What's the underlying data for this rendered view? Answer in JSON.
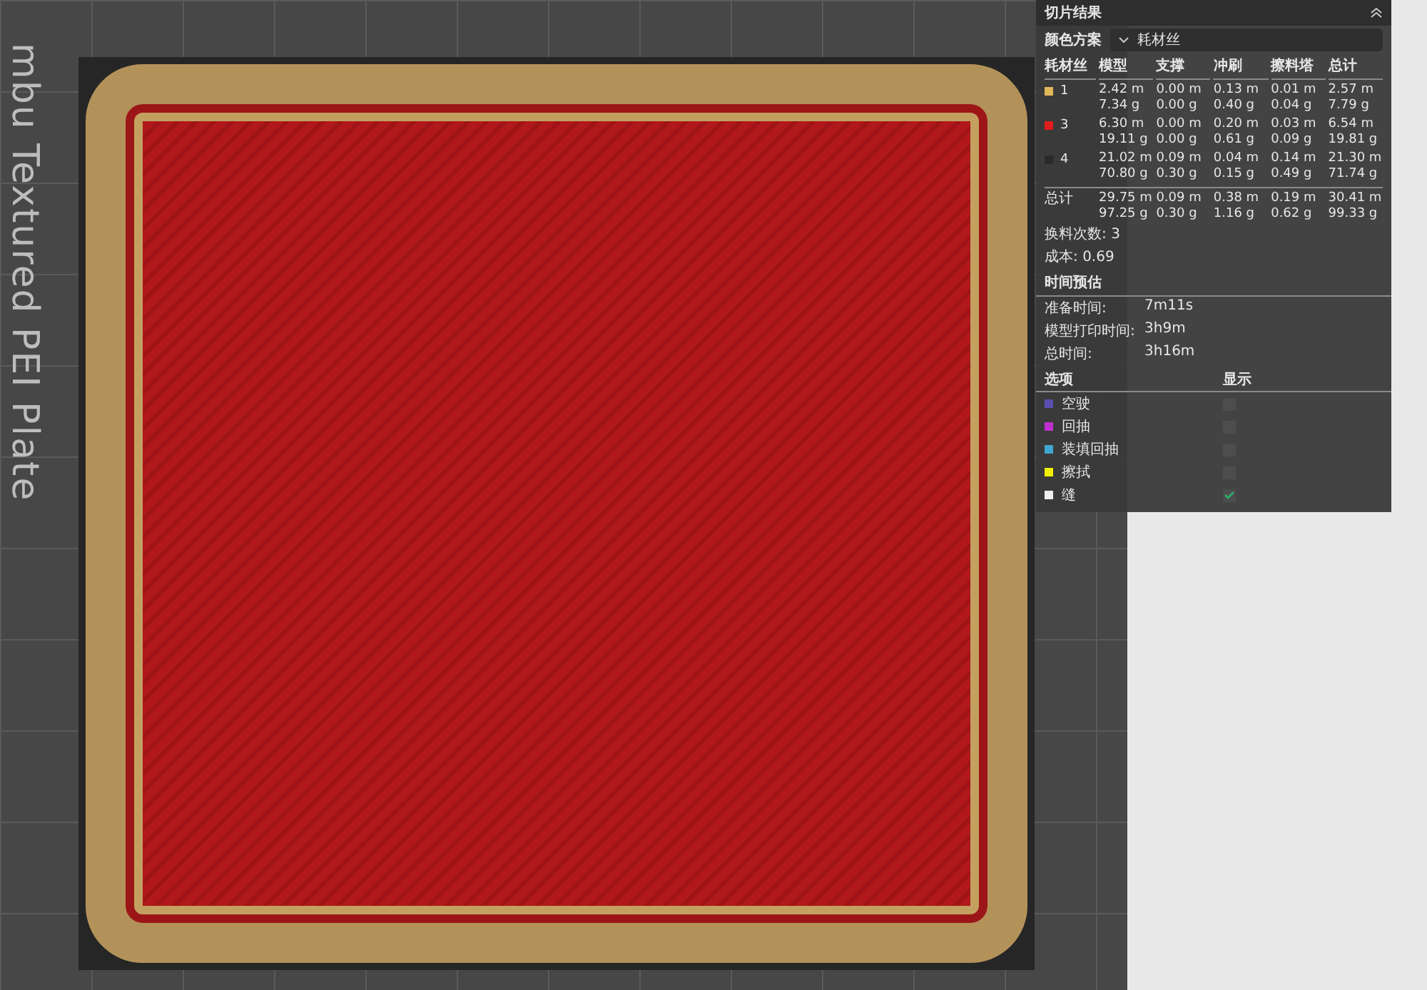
{
  "plate_label": "mbu Textured PEI Plate",
  "panel": {
    "title": "切片结果",
    "color_scheme": {
      "label": "颜色方案",
      "value": "耗材丝"
    },
    "filament_columns": [
      "耗材丝",
      "模型",
      "支撑",
      "冲刷",
      "擦料塔",
      "总计"
    ],
    "filaments": [
      {
        "id": "1",
        "color": "#e0b85a",
        "cells": [
          [
            "2.42 m",
            "7.34 g"
          ],
          [
            "0.00 m",
            "0.00 g"
          ],
          [
            "0.13 m",
            "0.40 g"
          ],
          [
            "0.01 m",
            "0.04 g"
          ],
          [
            "2.57 m",
            "7.79 g"
          ]
        ]
      },
      {
        "id": "3",
        "color": "#e01c1c",
        "cells": [
          [
            "6.30 m",
            "19.11 g"
          ],
          [
            "0.00 m",
            "0.00 g"
          ],
          [
            "0.20 m",
            "0.61 g"
          ],
          [
            "0.03 m",
            "0.09 g"
          ],
          [
            "6.54 m",
            "19.81 g"
          ]
        ]
      },
      {
        "id": "4",
        "color": "#2a2a2a",
        "cells": [
          [
            "21.02 m",
            "70.80 g"
          ],
          [
            "0.09 m",
            "0.30 g"
          ],
          [
            "0.04 m",
            "0.15 g"
          ],
          [
            "0.14 m",
            "0.49 g"
          ],
          [
            "21.30 m",
            "71.74 g"
          ]
        ]
      }
    ],
    "total": {
      "label": "总计",
      "cells": [
        [
          "29.75 m",
          "97.25 g"
        ],
        [
          "0.09 m",
          "0.30 g"
        ],
        [
          "0.38 m",
          "1.16 g"
        ],
        [
          "0.19 m",
          "0.62 g"
        ],
        [
          "30.41 m",
          "99.33 g"
        ]
      ]
    },
    "summary": [
      {
        "label": "换料次数:",
        "value": "3"
      },
      {
        "label": "成本:",
        "value": "0.69"
      }
    ],
    "time_title": "时间预估",
    "times": [
      {
        "label": "准备时间:",
        "value": "7m11s"
      },
      {
        "label": "模型打印时间:",
        "value": "3h9m"
      },
      {
        "label": "总时间:",
        "value": "3h16m"
      }
    ],
    "option_columns": [
      "选项",
      "显示"
    ],
    "options": [
      {
        "label": "空驶",
        "color": "#5a4fb0",
        "checked": false
      },
      {
        "label": "回抽",
        "color": "#c030d0",
        "checked": false
      },
      {
        "label": "装填回抽",
        "color": "#40a8d0",
        "checked": false
      },
      {
        "label": "擦拭",
        "color": "#f0f000",
        "checked": false
      },
      {
        "label": "缝",
        "color": "#f0f0f0",
        "checked": true
      }
    ]
  }
}
